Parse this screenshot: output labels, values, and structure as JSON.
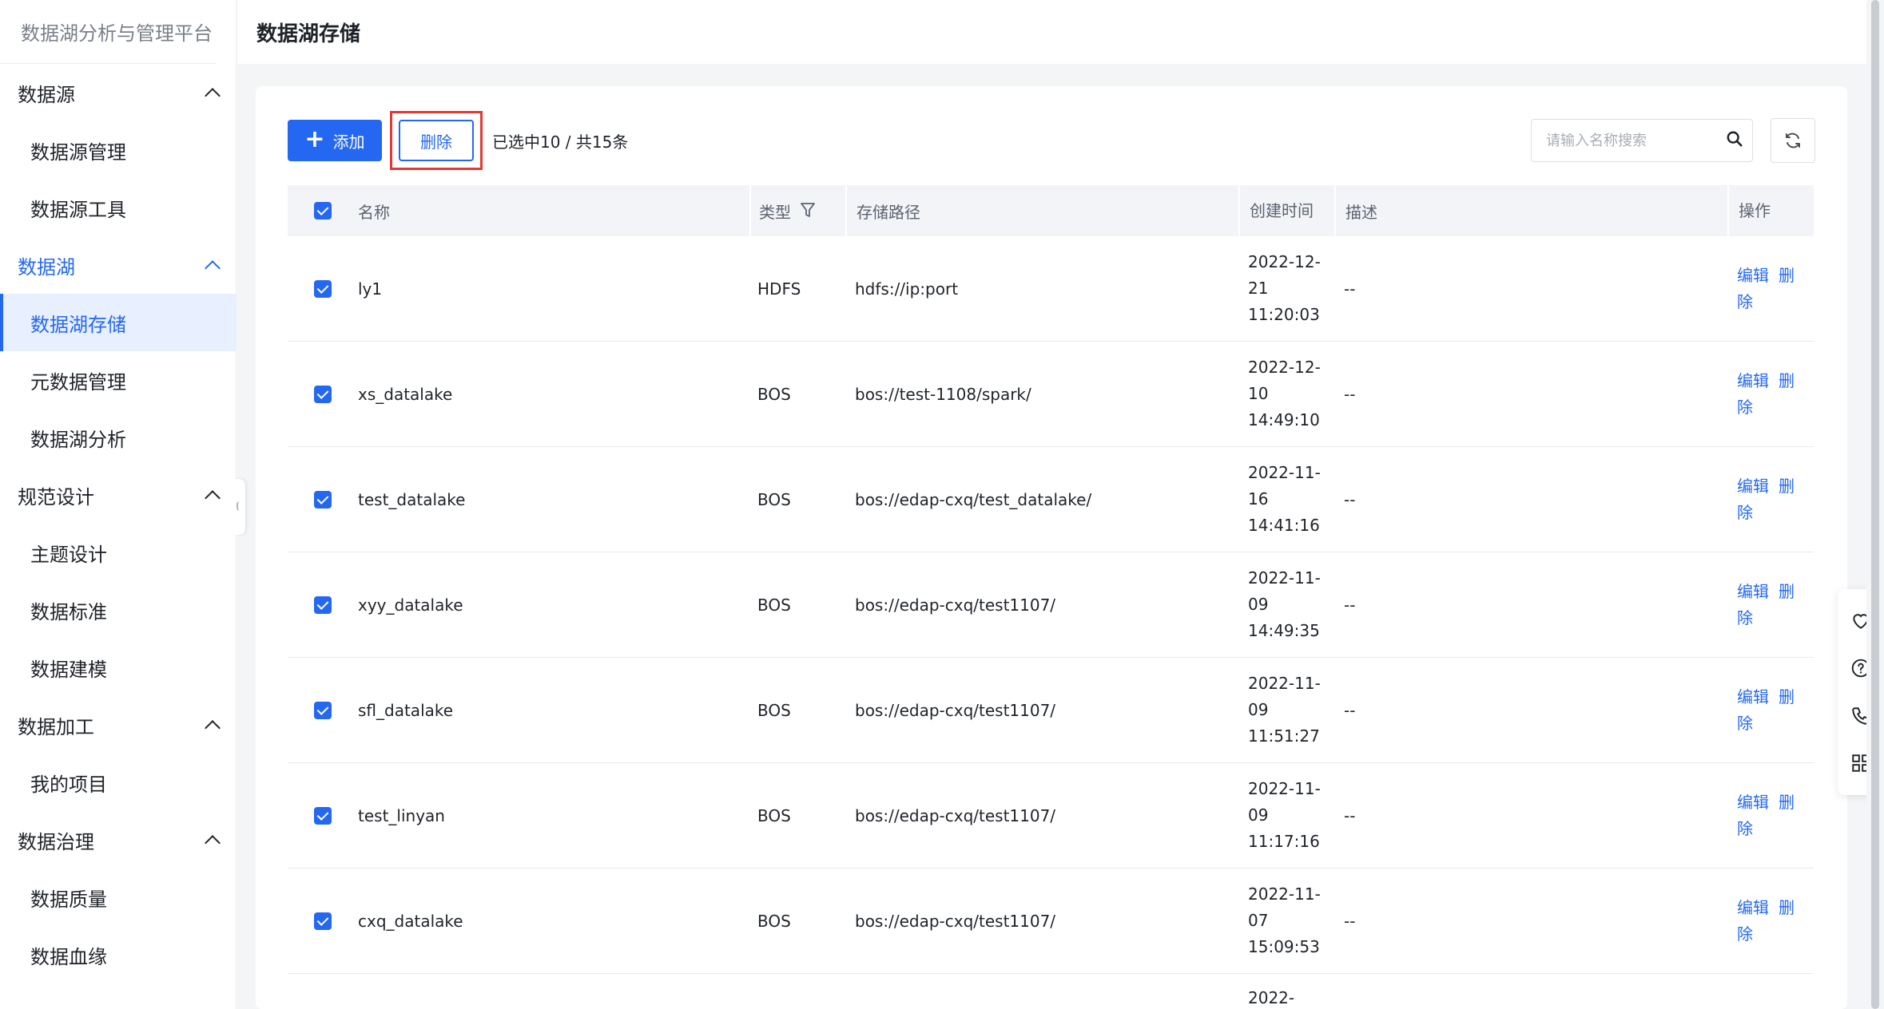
{
  "brand": "数据湖分析与管理平台",
  "sidebar": {
    "groups": [
      {
        "title": "数据源",
        "items": [
          "数据源管理",
          "数据源工具"
        ]
      },
      {
        "title": "数据湖",
        "items": [
          "数据湖存储",
          "元数据管理",
          "数据湖分析"
        ]
      },
      {
        "title": "规范设计",
        "items": [
          "主题设计",
          "数据标准",
          "数据建模"
        ]
      },
      {
        "title": "数据加工",
        "items": [
          "我的项目"
        ]
      },
      {
        "title": "数据治理",
        "items": [
          "数据质量",
          "数据血缘"
        ]
      }
    ]
  },
  "header": {
    "title": "数据湖存储"
  },
  "toolbar": {
    "add_label": "添加",
    "delete_label": "删除",
    "selected_info": "已选中10 / 共15条",
    "search_placeholder": "请输入名称搜索"
  },
  "table": {
    "columns": {
      "name": "名称",
      "type": "类型",
      "path": "存储路径",
      "time": "创建时间",
      "desc": "描述",
      "op": "操作"
    },
    "op_edit": "编辑",
    "op_delete": "删除",
    "rows": [
      {
        "name": "ly1",
        "type": "HDFS",
        "path": "hdfs://ip:port",
        "time_l1": "2022-12-",
        "time_l2": "21",
        "time_l3": "11:20:03",
        "desc": "--"
      },
      {
        "name": "xs_datalake",
        "type": "BOS",
        "path": "bos://test-1108/spark/",
        "time_l1": "2022-12-",
        "time_l2": "10",
        "time_l3": "14:49:10",
        "desc": "--"
      },
      {
        "name": "test_datalake",
        "type": "BOS",
        "path": "bos://edap-cxq/test_datalake/",
        "time_l1": "2022-11-",
        "time_l2": "16",
        "time_l3": "14:41:16",
        "desc": "--"
      },
      {
        "name": "xyy_datalake",
        "type": "BOS",
        "path": "bos://edap-cxq/test1107/",
        "time_l1": "2022-11-",
        "time_l2": "09",
        "time_l3": "14:49:35",
        "desc": "--"
      },
      {
        "name": "sfl_datalake",
        "type": "BOS",
        "path": "bos://edap-cxq/test1107/",
        "time_l1": "2022-11-",
        "time_l2": "09",
        "time_l3": "11:51:27",
        "desc": "--"
      },
      {
        "name": "test_linyan",
        "type": "BOS",
        "path": "bos://edap-cxq/test1107/",
        "time_l1": "2022-11-",
        "time_l2": "09",
        "time_l3": "11:17:16",
        "desc": "--"
      },
      {
        "name": "cxq_datalake",
        "type": "BOS",
        "path": "bos://edap-cxq/test1107/",
        "time_l1": "2022-11-",
        "time_l2": "07",
        "time_l3": "15:09:53",
        "desc": "--"
      }
    ],
    "partial_row_time": "2022-"
  },
  "float_tools": [
    "heart-icon",
    "help-icon",
    "phone-icon",
    "apps-icon"
  ],
  "colors": {
    "primary": "#2468f2",
    "highlight_border": "#e53935"
  }
}
